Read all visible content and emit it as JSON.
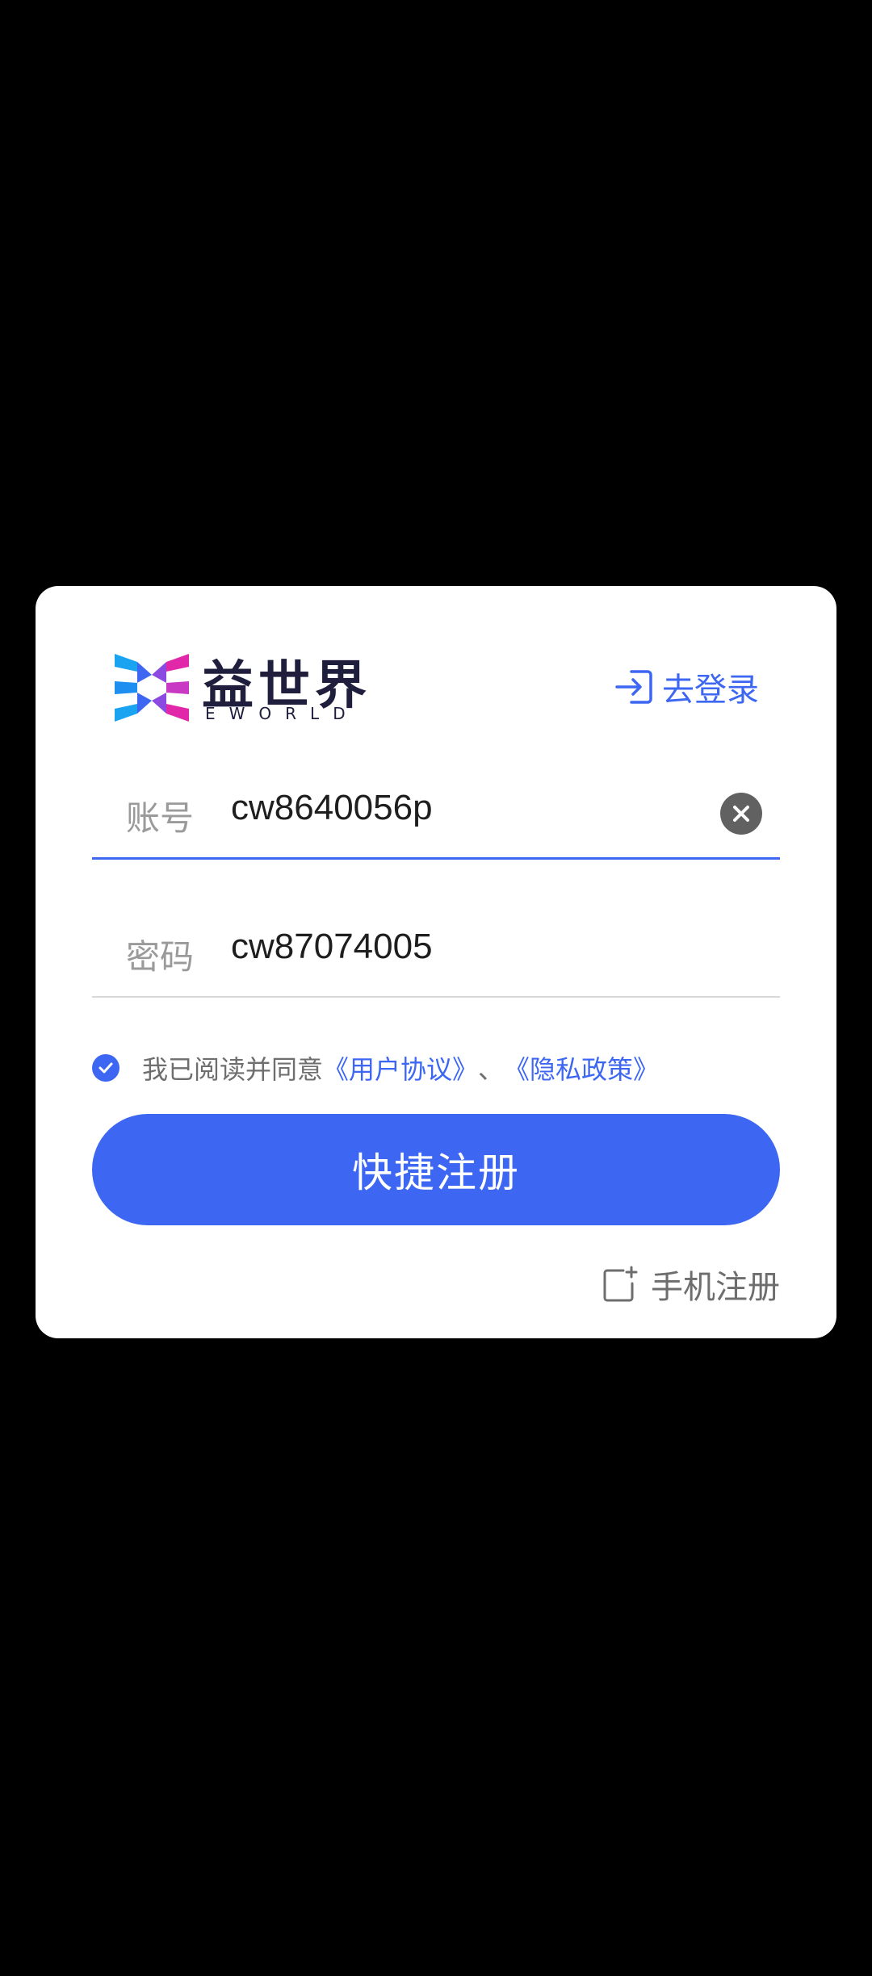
{
  "brand": {
    "name_cn": "益世界",
    "name_en": "EWORLD"
  },
  "header": {
    "login_link": "去登录",
    "login_icon": "login-icon"
  },
  "form": {
    "account": {
      "label": "账号",
      "value": "cw8640056p"
    },
    "password": {
      "label": "密码",
      "value": "cw87074005"
    }
  },
  "agreement": {
    "checked": true,
    "prefix": "我已阅读并同意",
    "user_agreement": "《用户协议》",
    "separator": "、",
    "privacy_policy": "《隐私政策》"
  },
  "actions": {
    "register": "快捷注册",
    "phone_register": "手机注册",
    "phone_icon": "phone-register-icon"
  },
  "colors": {
    "accent": "#3d67f2",
    "background": "#000000",
    "card": "#ffffff"
  }
}
